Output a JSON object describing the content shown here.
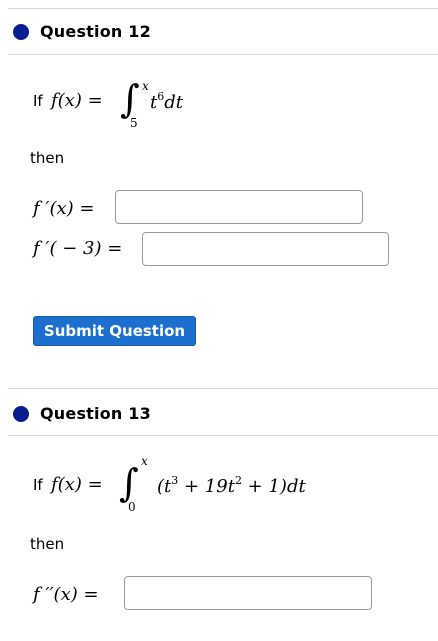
{
  "q12": {
    "title": "Question 12",
    "if_label": "If",
    "lhs": "f(x) =",
    "integral_upper": "x",
    "integral_lower": "5",
    "integrand_base": "t",
    "integrand_exp": "6",
    "integrand_dt": "dt",
    "then_label": "then",
    "answer1_label": "f ′(x) =",
    "answer2_label": "f ′( − 3) =",
    "answer1_value": "",
    "answer2_value": "",
    "submit_label": "Submit Question"
  },
  "q13": {
    "title": "Question 13",
    "if_label": "If",
    "lhs": "f(x) =",
    "integral_upper": "x",
    "integral_lower": "0",
    "integrand_open": "(t",
    "integrand_exp1": "3",
    "integrand_mid": " + 19t",
    "integrand_exp2": "2",
    "integrand_close": " + 1)",
    "integrand_dt": "dt",
    "then_label": "then",
    "answer1_label": "f ′′(x) =",
    "answer1_value": ""
  },
  "colors": {
    "bullet": "#0a1d8f",
    "button": "#1c6fcf"
  }
}
